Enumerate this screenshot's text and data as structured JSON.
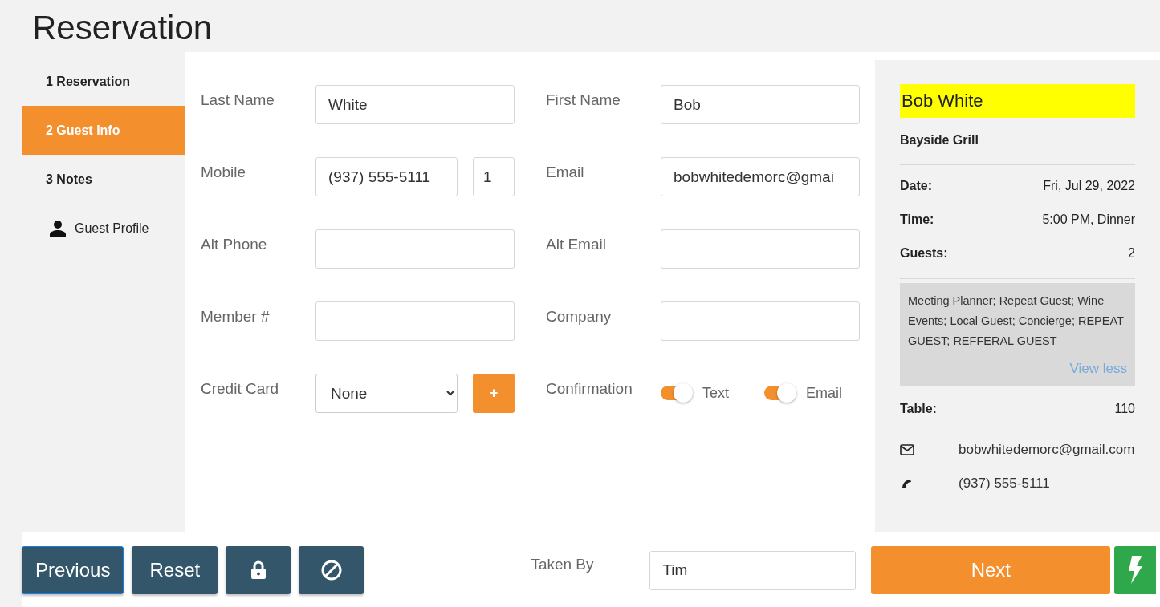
{
  "page": {
    "title": "Reservation"
  },
  "steps": [
    {
      "label": "1 Reservation",
      "selected": false,
      "kind": "step"
    },
    {
      "label": "2 Guest Info",
      "selected": true,
      "kind": "step"
    },
    {
      "label": "3 Notes",
      "selected": false,
      "kind": "step"
    },
    {
      "label": "Guest Profile",
      "selected": false,
      "kind": "profile"
    }
  ],
  "form": {
    "rows": [
      {
        "left": {
          "kind": "text",
          "label": "Last Name",
          "value": "White"
        },
        "right": {
          "kind": "text",
          "label": "First Name",
          "value": "Bob"
        }
      },
      {
        "left": {
          "kind": "phone",
          "label": "Mobile",
          "value": "(937) 555-5111",
          "extra": "1"
        },
        "right": {
          "kind": "text",
          "label": "Email",
          "value": "bobwhitedemorc@gmai"
        }
      },
      {
        "left": {
          "kind": "text",
          "label": "Alt Phone"
        },
        "right": {
          "kind": "text",
          "label": "Alt Email"
        }
      },
      {
        "left": {
          "kind": "text",
          "label": "Member #"
        },
        "right": {
          "kind": "text",
          "label": "Company"
        }
      },
      {
        "left": {
          "kind": "select",
          "label": "Credit Card",
          "value": "None",
          "button": "+"
        },
        "right": {
          "kind": "toggles",
          "label": "Confirmation",
          "toggles": [
            {
              "label": "Text",
              "on": true
            },
            {
              "label": "Email",
              "on": true
            }
          ]
        }
      }
    ]
  },
  "summary": {
    "name": "Bob White",
    "venue": "Bayside Grill",
    "details": [
      {
        "label": "Date:",
        "value": "Fri, Jul 29, 2022"
      },
      {
        "label": "Time:",
        "value": "5:00 PM, Dinner"
      },
      {
        "label": "Guests:",
        "value": "2"
      }
    ],
    "tags": "Meeting Planner; Repeat Guest; Wine Events; Local Guest; Concierge; REPEAT GUEST; REFFERAL GUEST",
    "tags_link": "View less",
    "table": {
      "label": "Table:",
      "value": "110"
    },
    "contacts": [
      {
        "kind": "email",
        "value": "bobwhitedemorc@gmail.com"
      },
      {
        "kind": "phone",
        "value": "(937) 555-5111"
      }
    ]
  },
  "footer": {
    "buttons": [
      {
        "kind": "text",
        "label": "Previous",
        "focused": true
      },
      {
        "kind": "text",
        "label": "Reset",
        "focused": false
      },
      {
        "kind": "lock",
        "focused": false
      },
      {
        "kind": "ban",
        "focused": false
      }
    ],
    "taken_by": {
      "label": "Taken By",
      "value": "Tim"
    },
    "next": "Next"
  }
}
